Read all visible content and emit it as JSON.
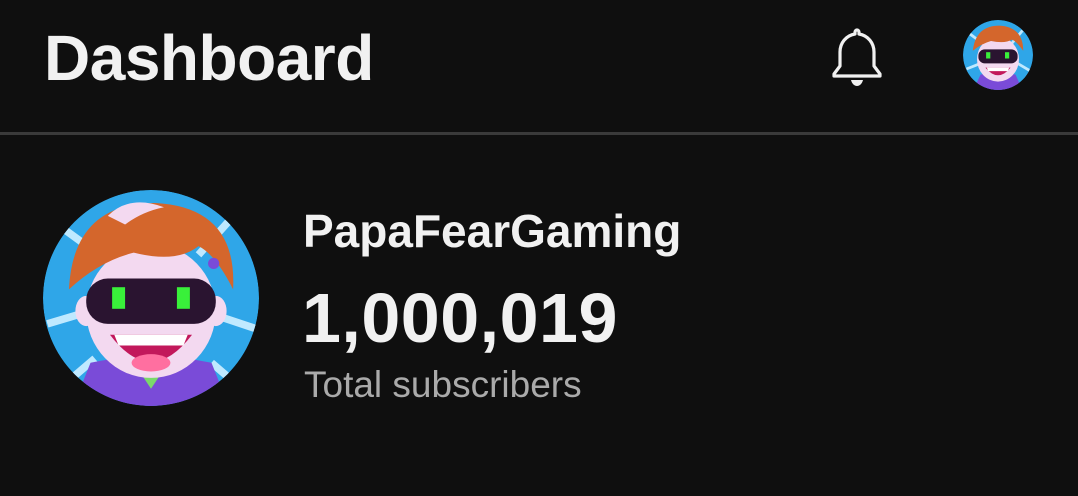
{
  "header": {
    "title": "Dashboard",
    "notifications_icon": "bell-icon",
    "account_icon": "avatar"
  },
  "channel": {
    "name": "PapaFearGaming",
    "subscriber_count": "1,000,019",
    "subscriber_label": "Total subscribers",
    "avatar_icon": "channel-avatar"
  },
  "colors": {
    "background": "#0f0f0f",
    "text_primary": "#f1f1f1",
    "text_secondary": "#aaaaaa",
    "divider": "#3a3a3a",
    "avatar_bg": "#2fa6e8"
  }
}
